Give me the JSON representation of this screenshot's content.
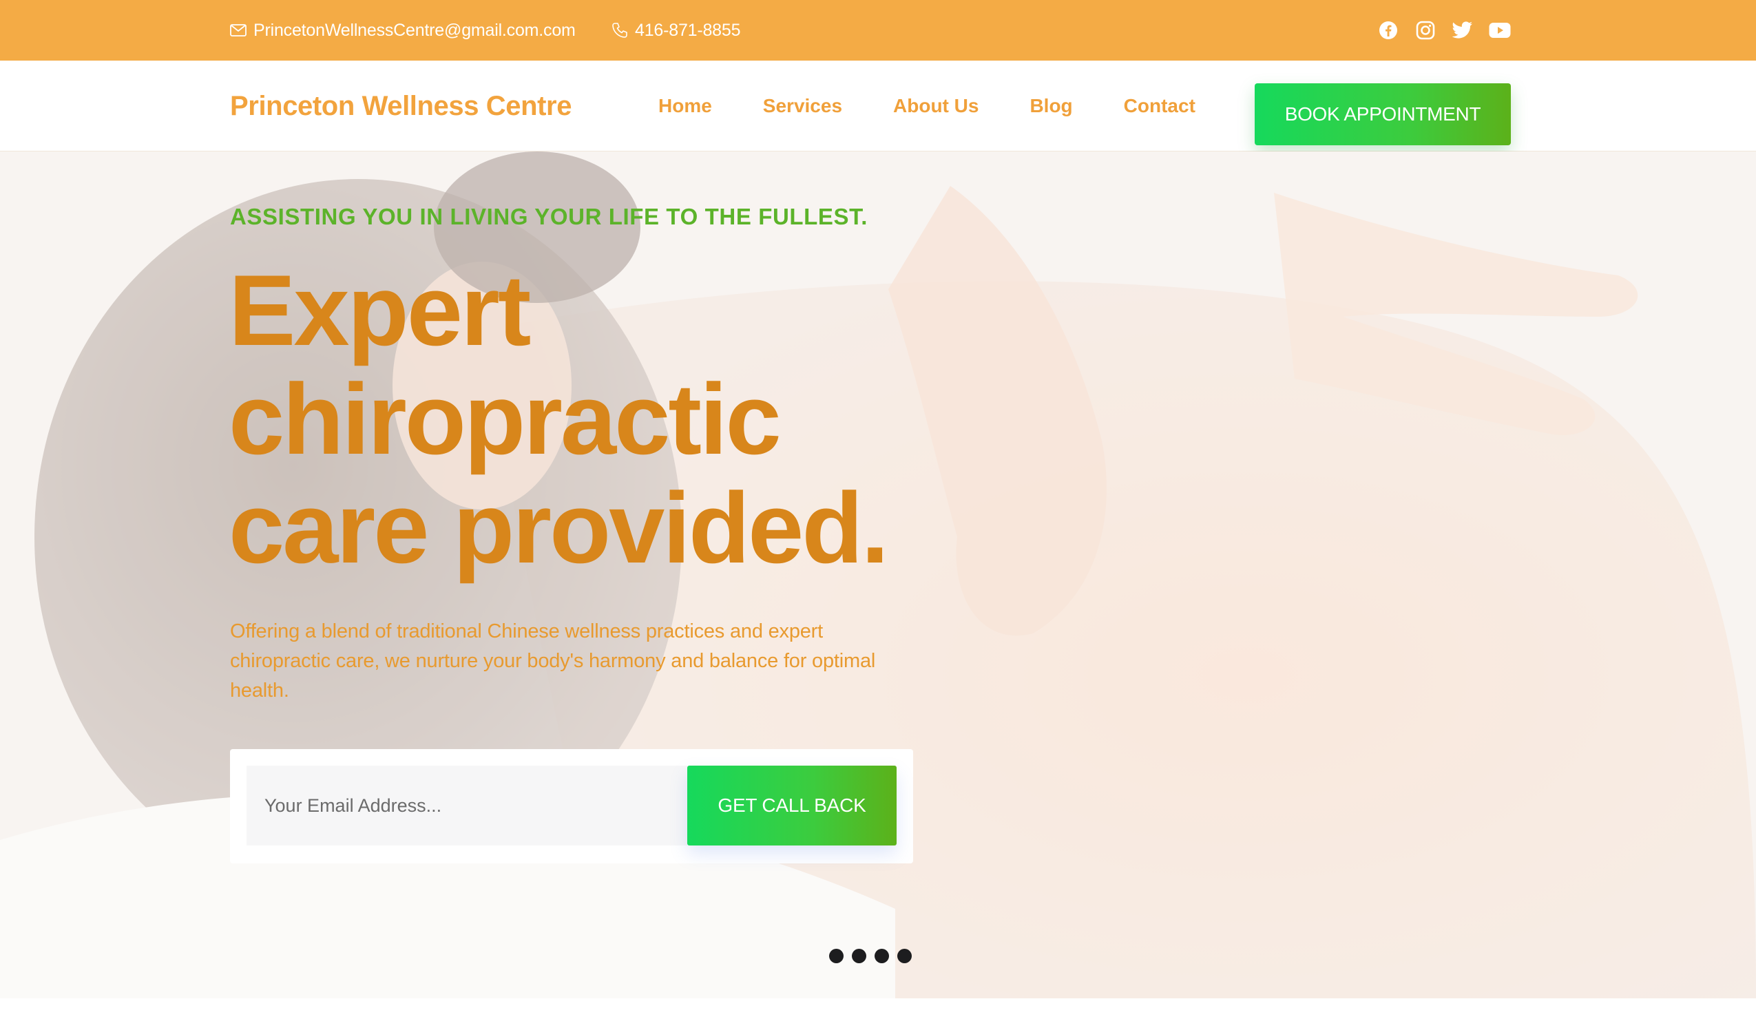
{
  "topbar": {
    "email": "PrincetonWellnessCentre@gmail.com.com",
    "phone": "416-871-8855",
    "socials": [
      "facebook-icon",
      "instagram-icon",
      "twitter-icon",
      "youtube-icon"
    ],
    "background": "#f4ab45"
  },
  "nav": {
    "brand": "Princeton Wellness Centre",
    "items": [
      {
        "label": "Home"
      },
      {
        "label": "Services"
      },
      {
        "label": "About Us"
      },
      {
        "label": "Blog"
      },
      {
        "label": "Contact"
      }
    ],
    "cta_label": "BOOK APPOINTMENT"
  },
  "hero": {
    "tagline": "ASSISTING YOU IN LIVING YOUR LIFE TO THE FULLEST.",
    "headline": [
      "Expert",
      "chiropractic",
      "care provided."
    ],
    "subtext": "Offering a blend of traditional Chinese wellness practices and expert chiropractic care, we nurture your body's harmony and balance for optimal health.",
    "email_placeholder": "Your Email Address...",
    "callback_label": "GET CALL BACK",
    "slide_count": 4
  },
  "colors": {
    "accent_orange": "#f4ab45",
    "headline_orange": "#d8861b",
    "tagline_green": "#5cb32a",
    "button_green": "#16d95c"
  }
}
